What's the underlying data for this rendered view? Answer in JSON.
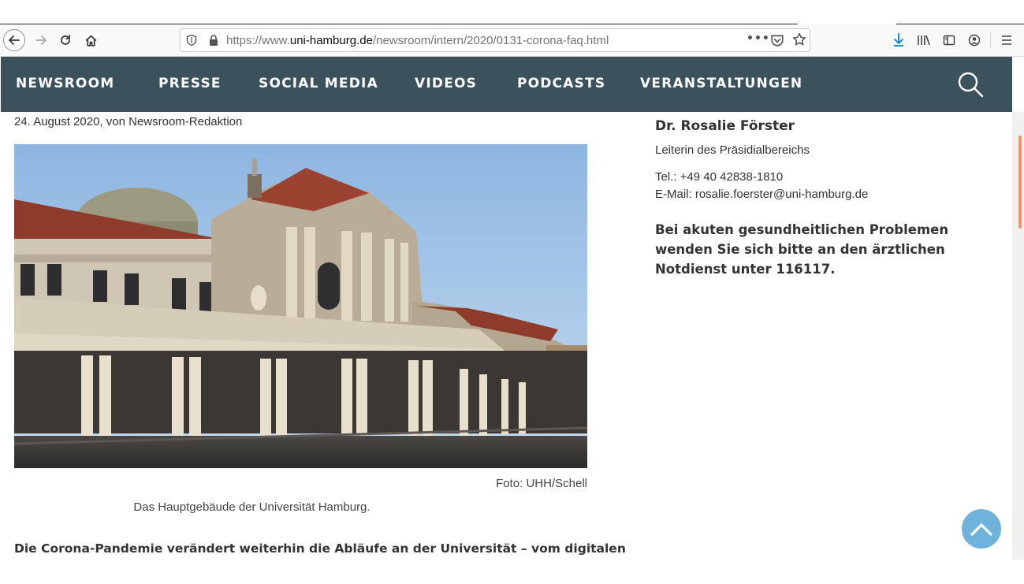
{
  "browser": {
    "url_prefix": "https://www.",
    "url_domain": "uni-hamburg.de",
    "url_path": "/newsroom/intern/2020/0131-corona-faq.html",
    "url_more": "•••",
    "icons": {
      "back": "back-arrow-icon",
      "forward": "forward-arrow-icon",
      "reload": "reload-icon",
      "home": "home-icon",
      "tracking": "shield-icon",
      "lock": "lock-icon",
      "pocket": "pocket-icon",
      "bookmark": "star-icon",
      "download": "download-icon",
      "library": "library-icon",
      "sidebar": "sidebar-icon",
      "account": "account-icon",
      "menu": "hamburger-menu-icon"
    },
    "download_color": "#0a84ff"
  },
  "site_nav": {
    "items": [
      {
        "label": "NEWSROOM"
      },
      {
        "label": "PRESSE"
      },
      {
        "label": "SOCIAL MEDIA"
      },
      {
        "label": "VIDEOS"
      },
      {
        "label": "PODCASTS"
      },
      {
        "label": "VERANSTALTUNGEN"
      }
    ],
    "background": "#3b515b",
    "search_icon": "search-icon"
  },
  "article": {
    "date_line": "24. August 2020, von Newsroom-Redaktion",
    "photo_credit": "Foto: UHH/Schell",
    "photo_caption": "Das Hauptgebäude der Universität Hamburg.",
    "lead": "Die Corona-Pandemie verändert weiterhin die Abläufe an der Universität – vom digitalen"
  },
  "contact": {
    "name": "Dr. Rosalie Förster",
    "role": "Leiterin des Präsidialbereichs",
    "tel": "Tel.: +49 40 42838-1810",
    "email": "E-Mail: rosalie.foerster@uni-hamburg.de",
    "notice": "Bei akuten gesundheitlichen Problemen wenden Sie sich bitte an den ärztlichen Notdienst unter 116117."
  },
  "back_to_top": {
    "icon": "chevron-up-icon",
    "color": "#6fb2dc"
  },
  "scrollbar": {
    "thumb_color": "#f0956b"
  }
}
